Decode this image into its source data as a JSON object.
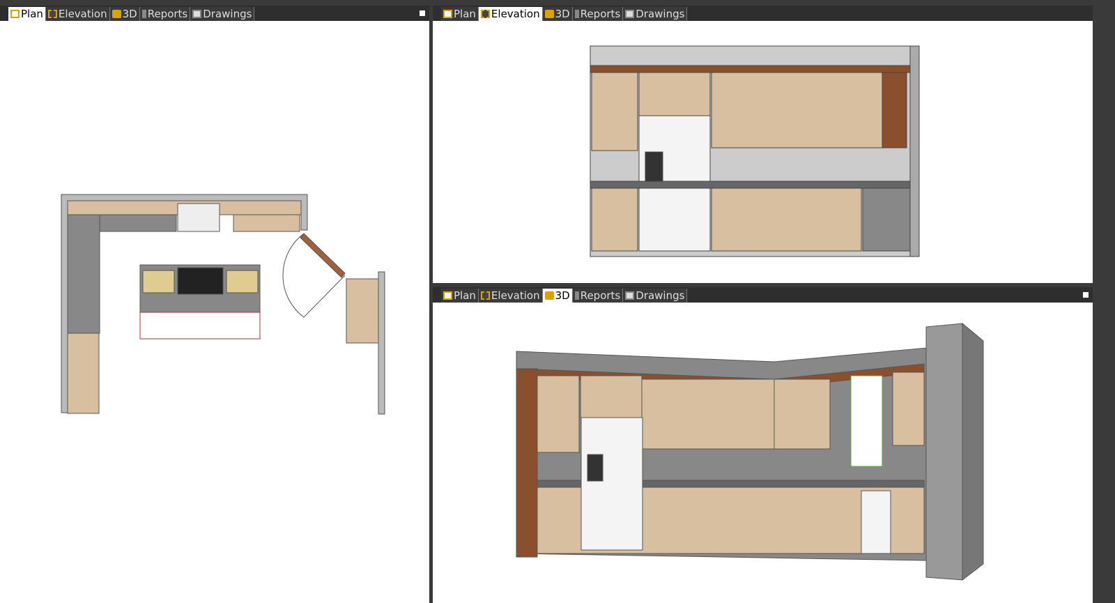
{
  "tabs": [
    {
      "label": "Plan",
      "icon": "plan-icon"
    },
    {
      "label": "Elevation",
      "icon": "elevation-icon"
    },
    {
      "label": "3D",
      "icon": "3d-box-icon"
    },
    {
      "label": "Reports",
      "icon": "reports-icon"
    },
    {
      "label": "Drawings",
      "icon": "drawings-icon"
    }
  ],
  "panes": {
    "left_active": "Plan",
    "top_right_active": "Elevation",
    "bottom_right_active": "3D"
  },
  "colors": {
    "cabinet": "#d8bfa0",
    "wood": "#8a4f2c",
    "wall": "#a8a8a8",
    "accent": "#d9a400"
  }
}
